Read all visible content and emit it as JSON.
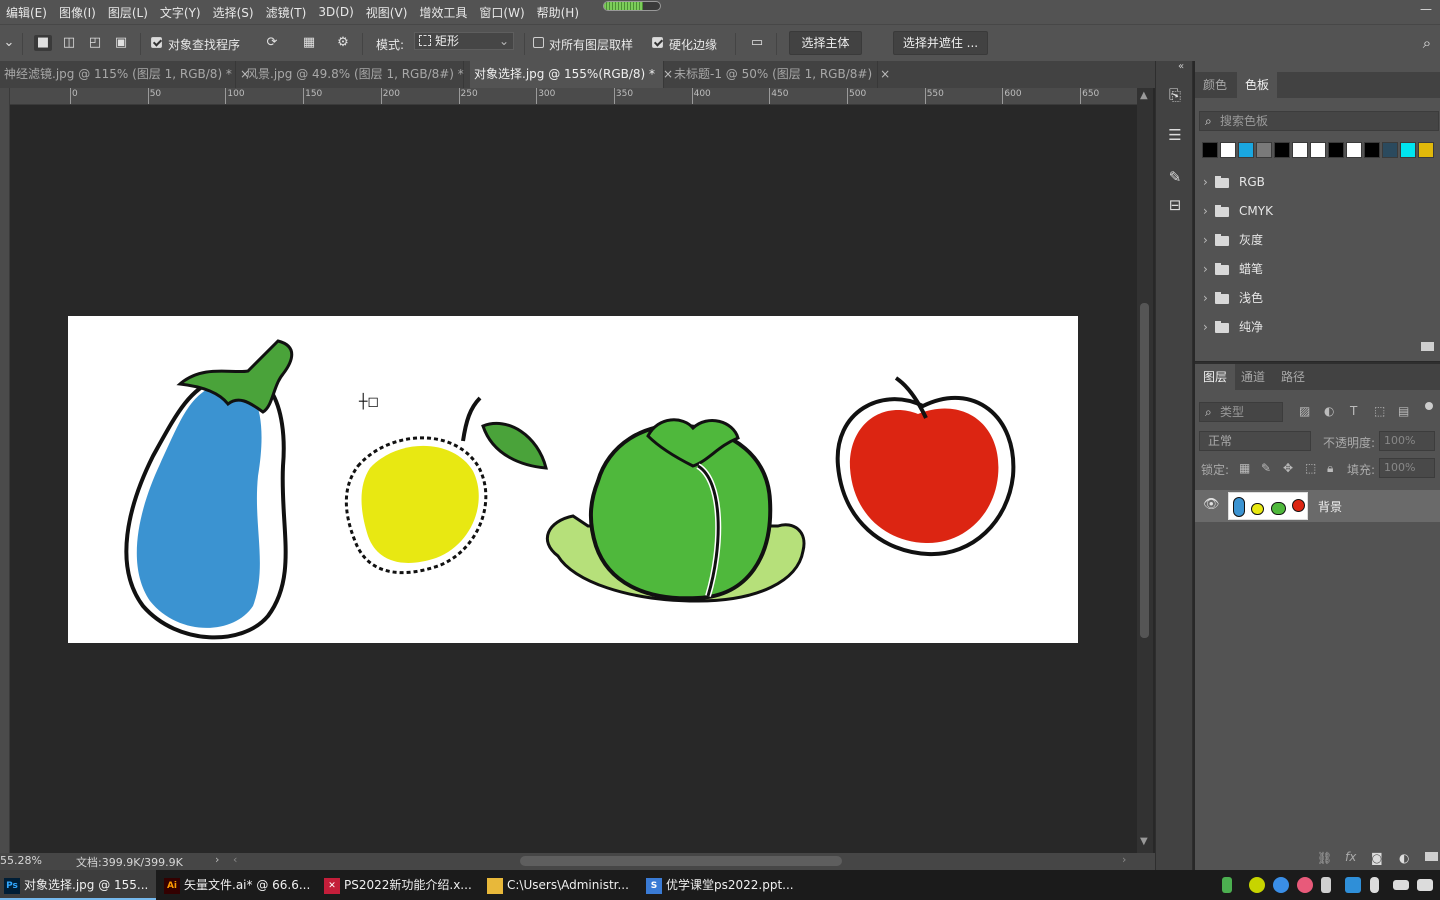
{
  "menu": [
    "编辑(E)",
    "图像(I)",
    "图层(L)",
    "文字(Y)",
    "选择(S)",
    "滤镜(T)",
    "3D(D)",
    "视图(V)",
    "增效工具",
    "窗口(W)",
    "帮助(H)"
  ],
  "options": {
    "object_finder_label": "对象查找程序",
    "mode_label": "模式:",
    "mode_value": "矩形",
    "sample_all_label": "对所有图层取样",
    "hard_edge_label": "硬化边缘",
    "select_subject": "选择主体",
    "select_mask": "选择并遮住 ..."
  },
  "tabs": [
    {
      "label": "神经滤镜.jpg @ 115% (图层 1, RGB/8) *"
    },
    {
      "label": "风景.jpg @ 49.8% (图层 1, RGB/8#) *"
    },
    {
      "label": "对象选择.jpg @ 155%(RGB/8) *"
    },
    {
      "label": "未标题-1 @ 50% (图层 1, RGB/8#)"
    }
  ],
  "ruler": [
    "0",
    "50",
    "100",
    "150",
    "200",
    "250",
    "300",
    "350",
    "400",
    "450",
    "500",
    "550",
    "600",
    "650"
  ],
  "status": {
    "zoom": "55.28%",
    "doc": "文档:399.9K/399.9K"
  },
  "swatches_panel": {
    "tabs": [
      "颜色",
      "色板"
    ],
    "search_placeholder": "搜索色板",
    "colors": [
      "#000000",
      "#ffffff",
      "#1aa7e0",
      "#7a7a7a",
      "#000000",
      "#ffffff",
      "#ffffff",
      "#000000",
      "#ffffff",
      "#000000",
      "#2b4a5e",
      "#00e5f0",
      "#e1b80a"
    ],
    "groups": [
      "RGB",
      "CMYK",
      "灰度",
      "蜡笔",
      "浅色",
      "纯净"
    ]
  },
  "layers_panel": {
    "tabs": [
      "图层",
      "通道",
      "路径"
    ],
    "filter_placeholder": "类型",
    "blend_mode": "正常",
    "opacity_label": "不透明度:",
    "opacity_value": "100%",
    "lock_label": "锁定:",
    "fill_label": "填充:",
    "fill_value": "100%",
    "layer_name": "背景"
  },
  "taskbar": [
    {
      "label": "对象选择.jpg @ 155...",
      "icon": "Ps",
      "color": "#001e36",
      "fg": "#31a8ff"
    },
    {
      "label": "矢量文件.ai* @ 66.6...",
      "icon": "Ai",
      "color": "#330000",
      "fg": "#ff9a00"
    },
    {
      "label": "PS2022新功能介绍.x...",
      "icon": "✕",
      "color": "#c41e3a",
      "fg": "#ffffff"
    },
    {
      "label": "C:\\Users\\Administr...",
      "icon": "▬",
      "color": "#e8b83a",
      "fg": "#e8b83a"
    },
    {
      "label": "优学课堂ps2022.ppt...",
      "icon": "S",
      "color": "#3a7bd5",
      "fg": "#ffffff"
    }
  ]
}
